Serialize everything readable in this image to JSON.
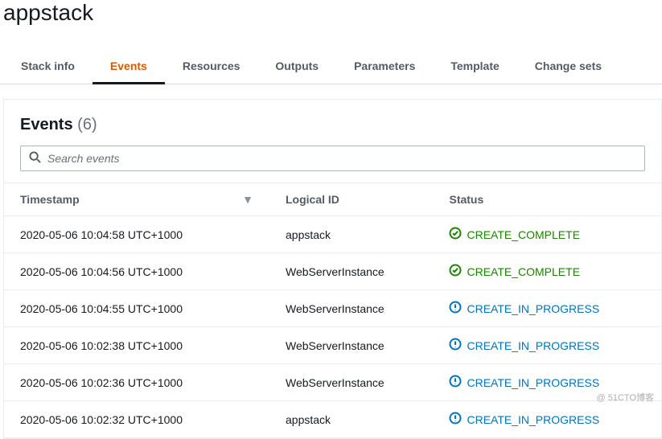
{
  "title": "appstack",
  "tabs": [
    {
      "label": "Stack info"
    },
    {
      "label": "Events",
      "active": true
    },
    {
      "label": "Resources"
    },
    {
      "label": "Outputs"
    },
    {
      "label": "Parameters"
    },
    {
      "label": "Template"
    },
    {
      "label": "Change sets"
    }
  ],
  "events_panel": {
    "title": "Events",
    "count_label": "(6)",
    "search_placeholder": "Search events",
    "columns": {
      "timestamp": "Timestamp",
      "logical_id": "Logical ID",
      "status": "Status"
    }
  },
  "events": [
    {
      "timestamp": "2020-05-06 10:04:58 UTC+1000",
      "logical_id": "appstack",
      "status": "CREATE_COMPLETE",
      "status_kind": "complete"
    },
    {
      "timestamp": "2020-05-06 10:04:56 UTC+1000",
      "logical_id": "WebServerInstance",
      "status": "CREATE_COMPLETE",
      "status_kind": "complete"
    },
    {
      "timestamp": "2020-05-06 10:04:55 UTC+1000",
      "logical_id": "WebServerInstance",
      "status": "CREATE_IN_PROGRESS",
      "status_kind": "progress"
    },
    {
      "timestamp": "2020-05-06 10:02:38 UTC+1000",
      "logical_id": "WebServerInstance",
      "status": "CREATE_IN_PROGRESS",
      "status_kind": "progress"
    },
    {
      "timestamp": "2020-05-06 10:02:36 UTC+1000",
      "logical_id": "WebServerInstance",
      "status": "CREATE_IN_PROGRESS",
      "status_kind": "progress"
    },
    {
      "timestamp": "2020-05-06 10:02:32 UTC+1000",
      "logical_id": "appstack",
      "status": "CREATE_IN_PROGRESS",
      "status_kind": "progress"
    }
  ],
  "watermark": "@ 51CTO博客"
}
